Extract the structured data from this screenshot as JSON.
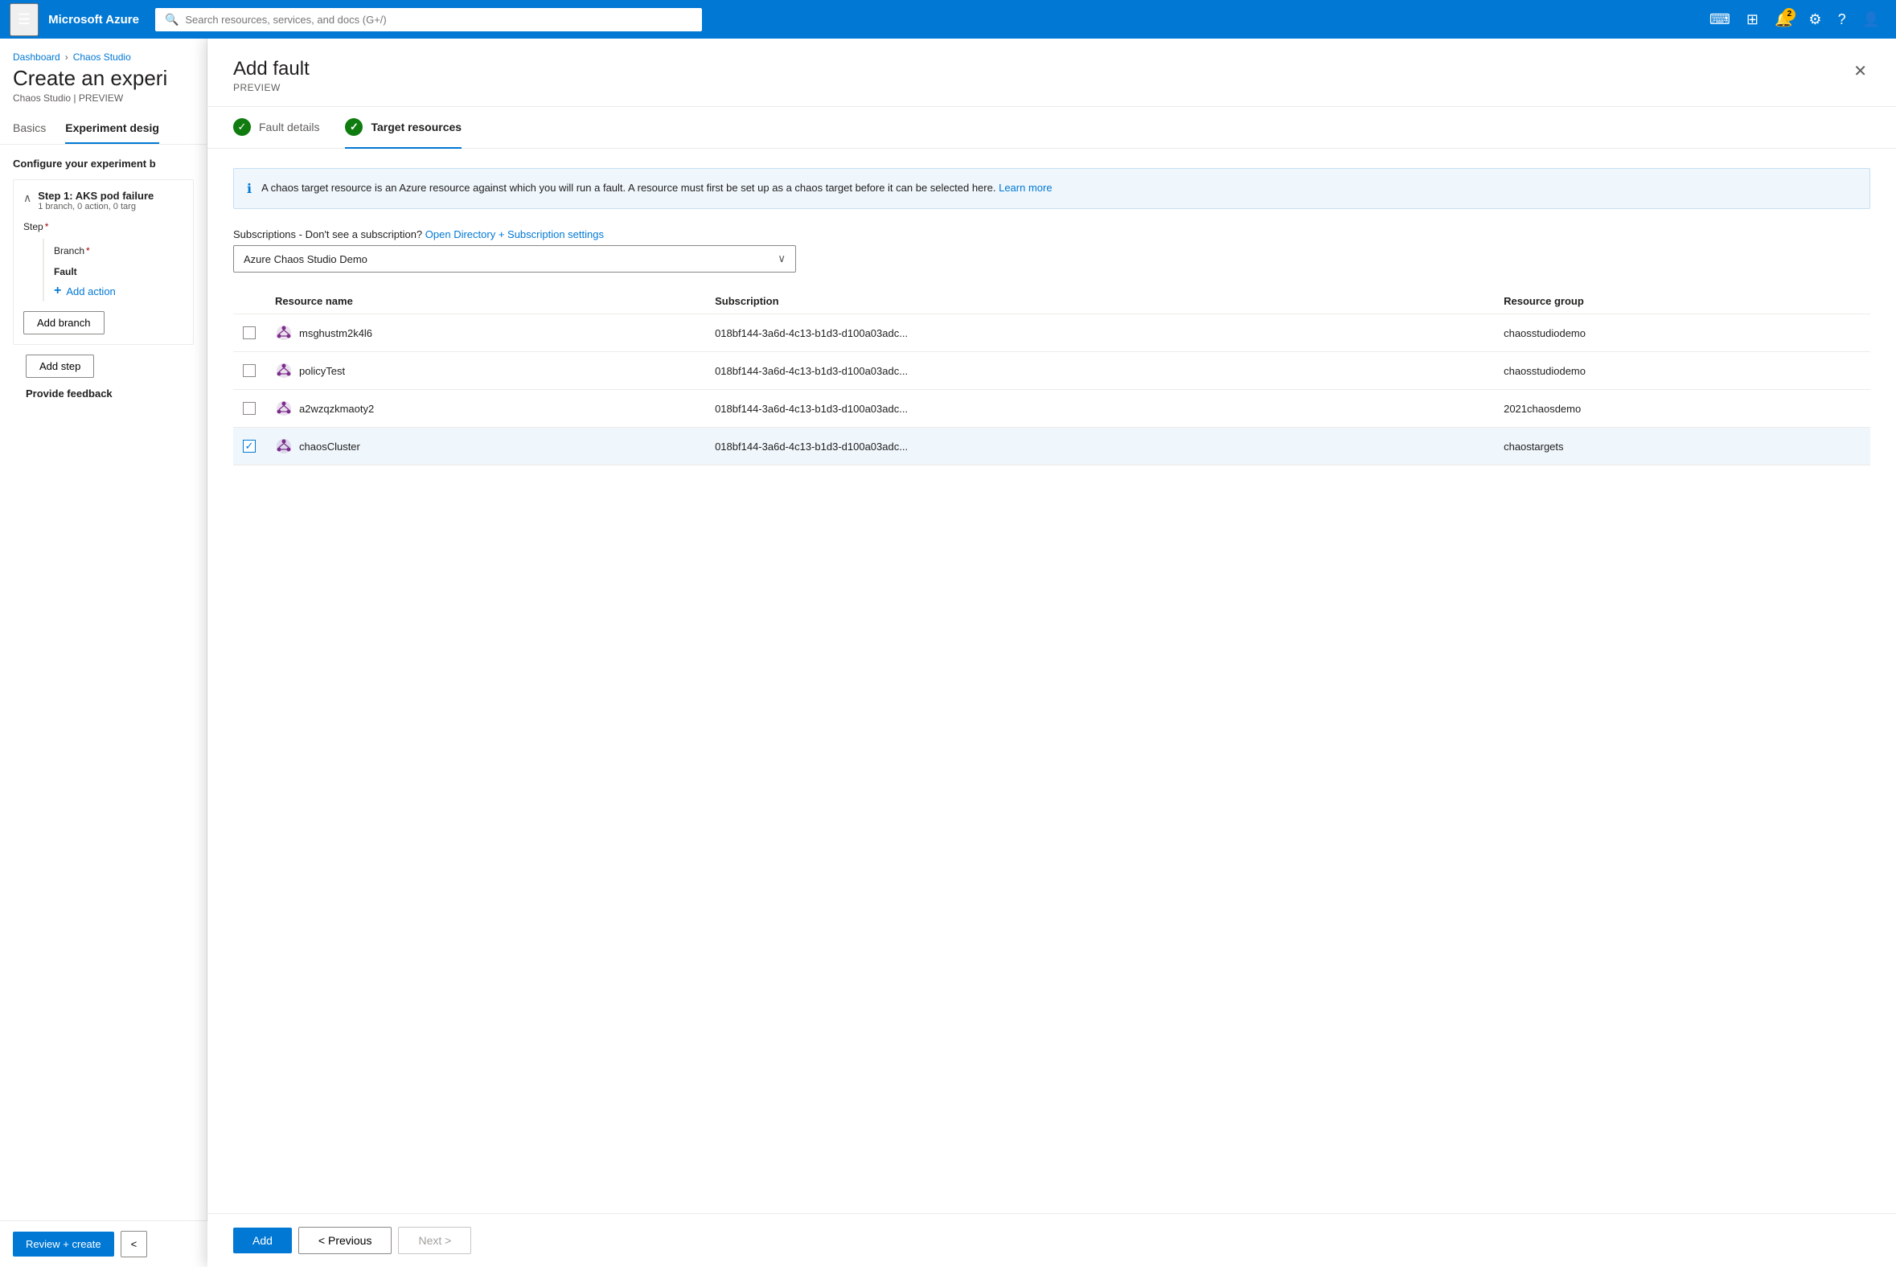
{
  "topnav": {
    "hamburger": "☰",
    "brand": "Microsoft Azure",
    "search_placeholder": "Search resources, services, and docs (G+/)",
    "notification_count": "2"
  },
  "breadcrumb": {
    "items": [
      "Dashboard",
      "Chaos Studio"
    ]
  },
  "page": {
    "title": "Create an experi",
    "subtitle": "Chaos Studio | PREVIEW",
    "tabs": [
      {
        "label": "Basics",
        "active": false
      },
      {
        "label": "Experiment desig",
        "active": true
      }
    ]
  },
  "left_panel": {
    "config_title": "Configure your experiment b",
    "step": {
      "name": "Step 1: AKS pod failure",
      "meta": "1 branch, 0 action, 0 targ",
      "step_label": "Step",
      "branch_label": "Branch",
      "fault_label": "Fault"
    },
    "add_action_label": "Add action",
    "add_branch_label": "Add branch",
    "add_step_label": "Add step",
    "provide_feedback_label": "Provide feedback"
  },
  "bottom_bar": {
    "review_create_label": "Review + create",
    "prev_label": "<"
  },
  "dialog": {
    "title": "Add fault",
    "subtitle": "PREVIEW",
    "close_label": "✕",
    "tabs": [
      {
        "label": "Fault details",
        "active": false,
        "checked": true
      },
      {
        "label": "Target resources",
        "active": true,
        "checked": true
      }
    ],
    "info_text": "A chaos target resource is an Azure resource against which you will run a fault. A resource must first be set up as a chaos target before it can be selected here.",
    "info_link_label": "Learn more",
    "subscription_label": "Subscriptions - Don't see a subscription?",
    "subscription_link_label": "Open Directory + Subscription settings",
    "subscription_selected": "Azure Chaos Studio Demo",
    "table": {
      "headers": [
        "",
        "Resource name",
        "Subscription",
        "Resource group"
      ],
      "rows": [
        {
          "name": "msghustm2k4l6",
          "subscription": "018bf144-3a6d-4c13-b1d3-d100a03adc...",
          "resource_group": "chaosstudiodemo",
          "selected": false
        },
        {
          "name": "policyTest",
          "subscription": "018bf144-3a6d-4c13-b1d3-d100a03adc...",
          "resource_group": "chaosstudiodemo",
          "selected": false
        },
        {
          "name": "a2wzqzkmaoty2",
          "subscription": "018bf144-3a6d-4c13-b1d3-d100a03adc...",
          "resource_group": "2021chaosdemo",
          "selected": false
        },
        {
          "name": "chaosCluster",
          "subscription": "018bf144-3a6d-4c13-b1d3-d100a03adc...",
          "resource_group": "chaostargets",
          "selected": true
        }
      ]
    },
    "footer": {
      "add_label": "Add",
      "prev_label": "< Previous",
      "next_label": "Next >"
    }
  }
}
